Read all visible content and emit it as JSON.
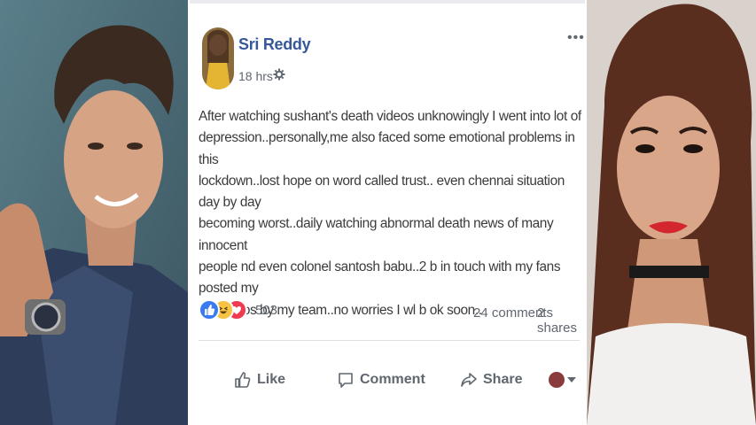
{
  "post": {
    "author": "Sri Reddy",
    "time": "18 hrs",
    "privacy_icon": "gear-icon",
    "more_options": "•••",
    "text": "After watching sushant's death videos unknowingly I went into lot of\ndepression..personally,me also faced some emotional problems in this\nlockdown..lost hope on word called trust.. even chennai situation day by day\nbecoming worst..daily watching abnormal death news of many innocent\npeople nd even colonel santosh babu..2 b in touch with my fans posted my\nold videos by my team..no worries I wl b ok soon..",
    "reactions": {
      "icons": [
        "like-reaction-icon",
        "haha-reaction-icon",
        "love-reaction-icon"
      ],
      "count": "503"
    },
    "comments_label": "24 comments",
    "shares_label": "2 shares"
  },
  "actions": {
    "like_label": "Like",
    "comment_label": "Comment",
    "share_label": "Share"
  },
  "colors": {
    "author_link": "#365899",
    "secondary_text": "#606770",
    "like_blue": "#3b7bf0",
    "love_red": "#ee3b52",
    "haha_yellow": "#f6c343"
  }
}
